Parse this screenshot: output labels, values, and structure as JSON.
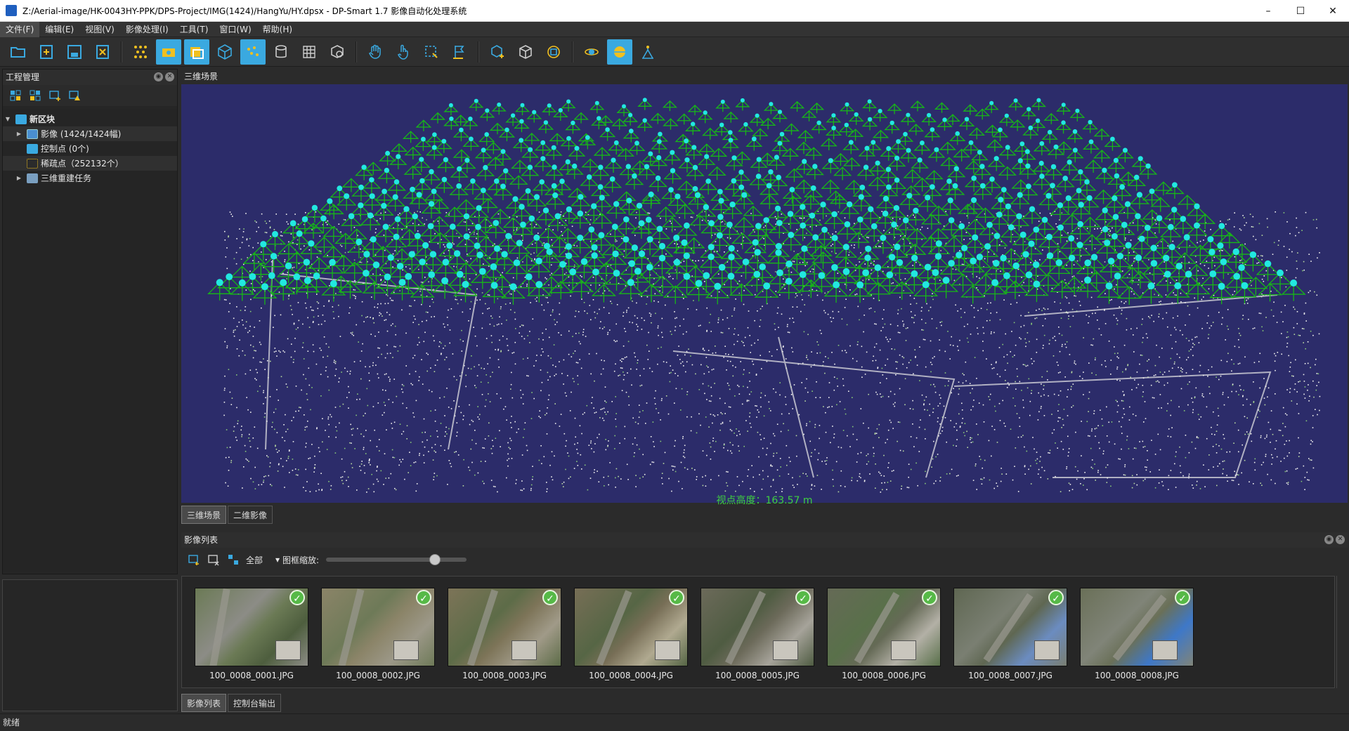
{
  "window": {
    "title": "Z:/Aerial-image/HK-0043HY-PPK/DPS-Project/IMG(1424)/HangYu/HY.dpsx - DP-Smart 1.7 影像自动化处理系统",
    "minimize": "–",
    "maximize": "☐",
    "close": "✕"
  },
  "menu": [
    "文件(F)",
    "编辑(E)",
    "视图(V)",
    "影像处理(I)",
    "工具(T)",
    "窗口(W)",
    "帮助(H)"
  ],
  "project_panel": {
    "title": "工程管理",
    "tree": {
      "root": "新区块",
      "items": [
        "影像 (1424/1424幅)",
        "控制点 (0个)",
        "稀疏点（252132个）",
        "三维重建任务"
      ]
    }
  },
  "scene_panel": {
    "title": "三维场景",
    "view_height": "视点高度：163.57 m",
    "tabs": [
      "三维场景",
      "二维影像"
    ]
  },
  "image_list": {
    "title": "影像列表",
    "filter_label": "全部",
    "zoom_label": "图框缩放:",
    "zoom_level": 0.8,
    "thumbnails": [
      "100_0008_0001.JPG",
      "100_0008_0002.JPG",
      "100_0008_0003.JPG",
      "100_0008_0004.JPG",
      "100_0008_0005.JPG",
      "100_0008_0006.JPG",
      "100_0008_0007.JPG",
      "100_0008_0008.JPG"
    ],
    "check_glyph": "✓"
  },
  "bottom_tabs": [
    "影像列表",
    "控制台输出"
  ],
  "status": "就绪",
  "colors": {
    "scene_bg": "#2c2c6a",
    "camera_green": "#17b717",
    "camera_cyan": "#22e8e0",
    "status_green": "#3fcf3f",
    "toolbar_active": "#3aa9e0"
  }
}
